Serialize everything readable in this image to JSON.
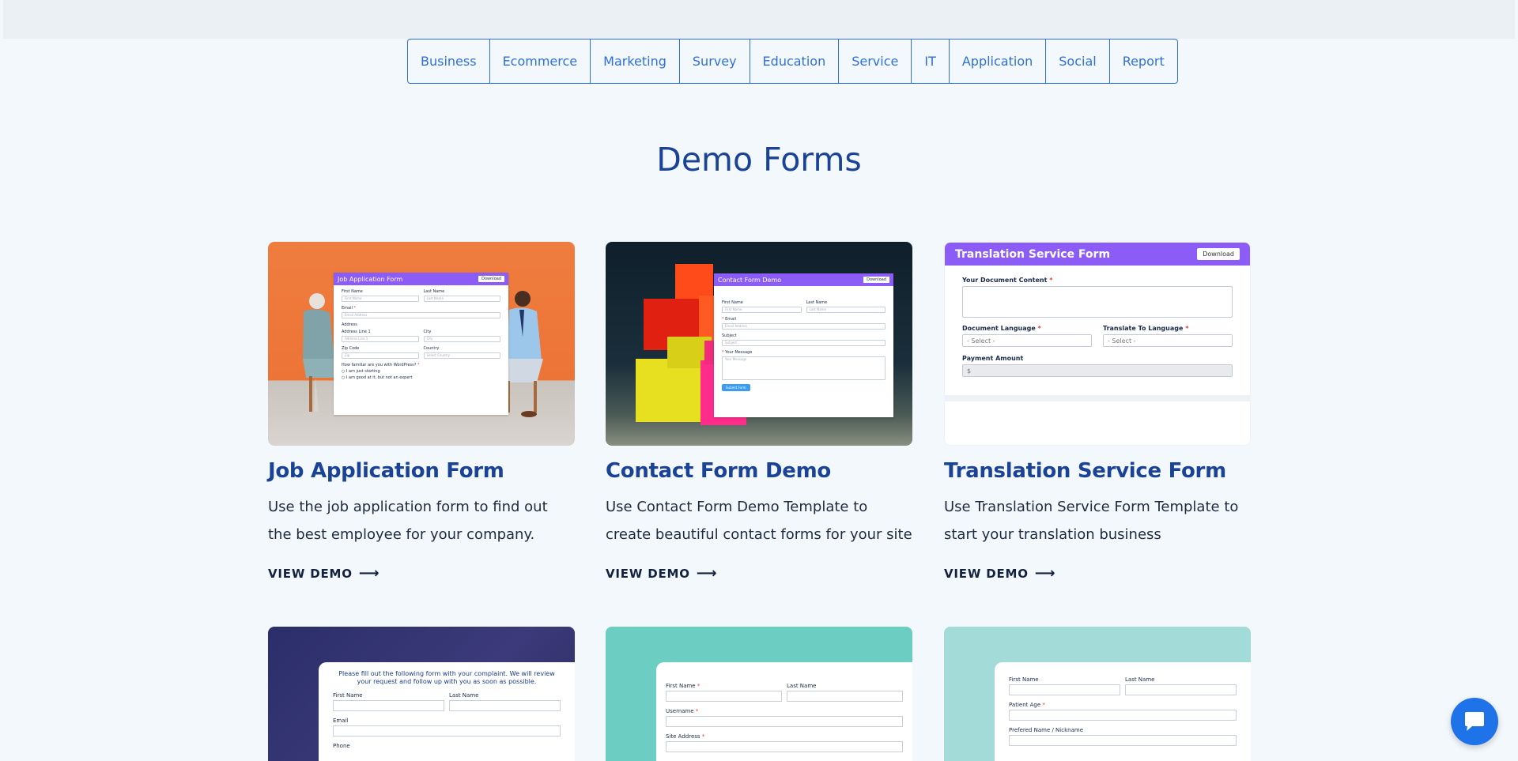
{
  "categories": [
    "Business",
    "Ecommerce",
    "Marketing",
    "Survey",
    "Education",
    "Service",
    "IT",
    "Application",
    "Social",
    "Report"
  ],
  "section_title": "Demo Forms",
  "cards": [
    {
      "title": "Job Application Form",
      "description": "Use the job application form to find out the best employee for your company.",
      "cta": "VIEW DEMO",
      "preview": {
        "form_title": "Job Application Form",
        "download": "Download",
        "first_name": "First Name",
        "last_name": "Last Name",
        "first_name_ph": "First Name",
        "last_name_ph": "Last Name",
        "email": "Email",
        "email_ph": "Email Address",
        "address": "Address",
        "address_line1": "Address Line 1",
        "address_line1_ph": "Address Line 1",
        "city": "City",
        "city_ph": "City",
        "zip": "Zip Code",
        "zip_ph": "Zip",
        "country": "Country",
        "country_ph": "Select Country",
        "question": "How familiar are you with WordPress?",
        "opt1": "I am just starting",
        "opt2": "I am good at it, but not an expert"
      }
    },
    {
      "title": "Contact Form Demo",
      "description": "Use Contact Form Demo Template to create beautiful contact forms for your site",
      "cta": "VIEW DEMO",
      "preview": {
        "form_title": "Contact Form Demo",
        "download": "Download",
        "first_name": "First Name",
        "last_name": "Last Name",
        "first_name_ph": "First Name",
        "last_name_ph": "Last Name",
        "email": "Email",
        "email_ph": "Email Address",
        "subject": "Subject",
        "subject_ph": "Subject",
        "message": "Your Message",
        "message_ph": "Your Message",
        "submit": "Submit Form"
      }
    },
    {
      "title": "Translation Service Form",
      "description": "Use Translation Service Form Template to start your translation business",
      "cta": "VIEW DEMO",
      "preview": {
        "form_title": "Translation Service Form",
        "download": "Download",
        "doc_content": "Your Document Content",
        "doc_language": "Document Language",
        "translate_to": "Translate To Language",
        "select_ph": "- Select -",
        "payment": "Payment Amount",
        "currency": "$"
      }
    }
  ],
  "row2": [
    {
      "intro": "Please fill out the following form with your complaint. We will review your request and follow up with you as soon as possible.",
      "first_name": "First Name",
      "last_name": "Last Name",
      "email": "Email",
      "phone": "Phone"
    },
    {
      "first_name": "First Name",
      "last_name": "Last Name",
      "username": "Username",
      "site_address": "Site Address"
    },
    {
      "first_name": "First Name",
      "last_name": "Last Name",
      "patient_age": "Patient Age",
      "preferred_name": "Prefered Name / Nickname"
    }
  ],
  "colors": {
    "accent": "#2f6fdb",
    "heading": "#1a4396",
    "chat": "#1e73e8"
  }
}
